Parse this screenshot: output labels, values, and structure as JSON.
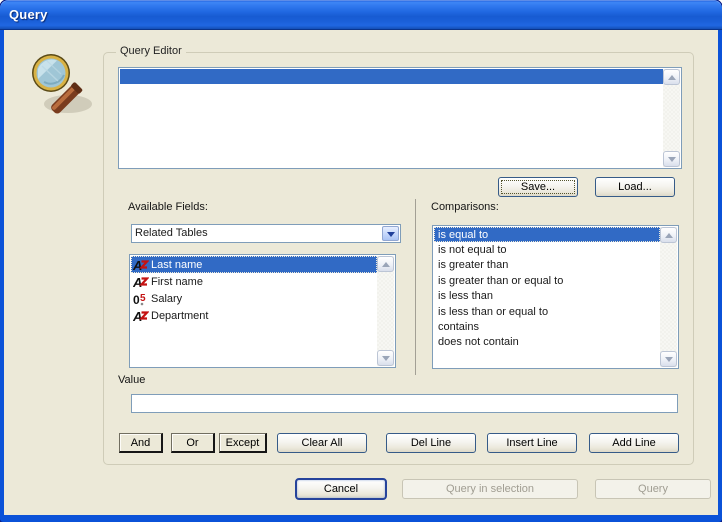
{
  "window": {
    "title": "Query"
  },
  "colors": {
    "dialog_bg": "#ece9d8",
    "titlebar_blue": "#1a5fd8",
    "selection_blue": "#316ac5",
    "control_border": "#7f9db9",
    "disabled_text": "#a09d92"
  },
  "icons": {
    "window_icon": "magnifying-glass",
    "alpha_field": "alpha-field-icon",
    "numeric_field": "numeric-field-icon",
    "combo": "chevron-down-icon",
    "scroll": [
      "scroll-up-arrow",
      "scroll-down-arrow"
    ]
  },
  "query_editor": {
    "group_label": "Query Editor",
    "rows": [
      ""
    ],
    "selected_row_index": 0,
    "save_label": "Save...",
    "load_label": "Load..."
  },
  "available_fields": {
    "label": "Available Fields:",
    "combo_value": "Related Tables",
    "items": [
      {
        "name": "Last name",
        "type": "alpha",
        "selected": true
      },
      {
        "name": "First name",
        "type": "alpha",
        "selected": false
      },
      {
        "name": "Salary",
        "type": "numeric",
        "selected": false
      },
      {
        "name": "Department",
        "type": "alpha",
        "selected": false
      }
    ]
  },
  "comparisons": {
    "label": "Comparisons:",
    "selected_index": 0,
    "items": [
      "is equal to",
      "is not equal to",
      "is greater than",
      "is greater than or equal to",
      "is less than",
      "is less than or equal to",
      "contains",
      "does not contain"
    ]
  },
  "value_box": {
    "label": "Value",
    "text": ""
  },
  "operators": {
    "and": "And",
    "or": "Or",
    "except": "Except"
  },
  "line_buttons": [
    "Clear All",
    "Del Line",
    "Insert Line",
    "Add Line"
  ],
  "footer": {
    "cancel": "Cancel",
    "query_in_selection": "Query in selection",
    "query": "Query",
    "query_in_selection_disabled": true,
    "query_disabled": true
  }
}
